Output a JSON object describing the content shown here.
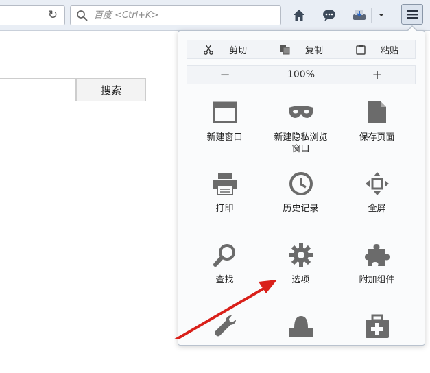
{
  "toolbar": {
    "reload_icon": "reload-icon",
    "search_placeholder": "百度 <Ctrl+K>",
    "home_icon": "home-icon",
    "chat_icon": "chat-bubble-icon",
    "download_icon": "download-icon",
    "dropdown_icon": "chevron-down-icon",
    "menu_icon": "hamburger-menu-icon"
  },
  "page": {
    "search_button_label": "搜索"
  },
  "menu": {
    "edit": {
      "cut_label": "剪切",
      "copy_label": "复制",
      "paste_label": "粘贴"
    },
    "zoom": {
      "out_label": "−",
      "level": "100%",
      "in_label": "+"
    },
    "items": [
      {
        "label": "新建窗口",
        "icon": "new-window-icon"
      },
      {
        "label": "新建隐私浏览窗口",
        "icon": "private-mask-icon"
      },
      {
        "label": "保存页面",
        "icon": "save-page-icon"
      },
      {
        "label": "打印",
        "icon": "printer-icon"
      },
      {
        "label": "历史记录",
        "icon": "clock-icon"
      },
      {
        "label": "全屏",
        "icon": "fullscreen-icon"
      },
      {
        "label": "查找",
        "icon": "magnifier-icon"
      },
      {
        "label": "选项",
        "icon": "gear-icon"
      },
      {
        "label": "附加组件",
        "icon": "puzzle-icon"
      },
      {
        "label": "",
        "icon": "wrench-icon"
      },
      {
        "label": "",
        "icon": "persona-icon"
      },
      {
        "label": "",
        "icon": "medkit-icon"
      }
    ]
  },
  "colors": {
    "toolbar_bg": "#e9eef5",
    "panel_bg": "#fafbfc",
    "icon_gray": "#6b6b6b",
    "annotation_arrow": "#d9201a"
  }
}
